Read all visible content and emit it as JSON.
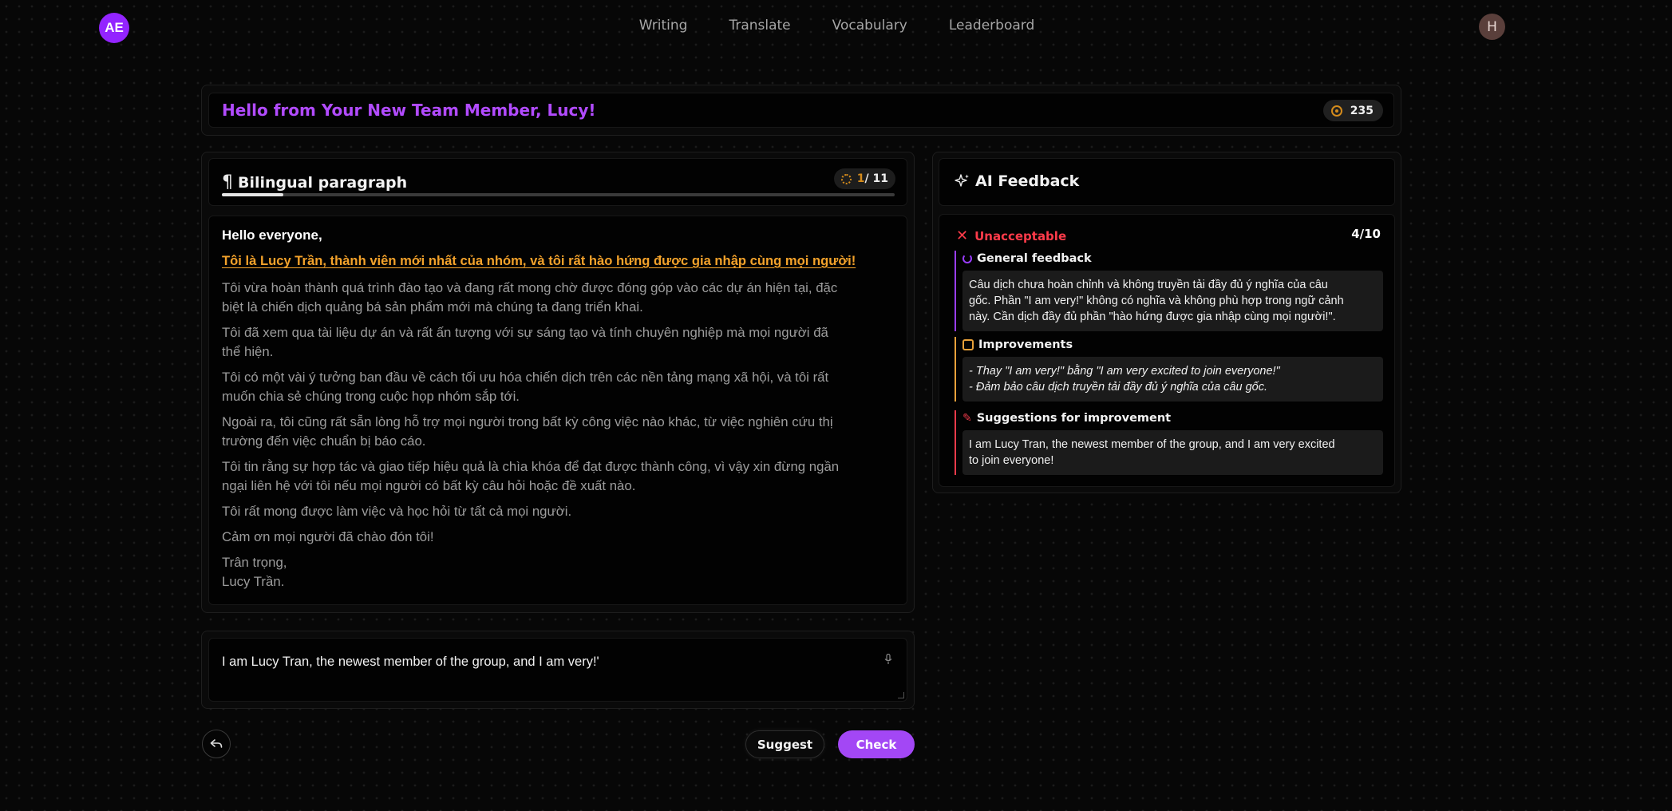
{
  "nav": {
    "user_initials": "AE",
    "links": [
      "Writing",
      "Translate",
      "Vocabulary",
      "Leaderboard"
    ],
    "profile_initial": "H"
  },
  "header": {
    "title": "Hello from Your New Team Member, Lucy!",
    "score": "235"
  },
  "paragraph_panel": {
    "title": "Bilingual paragraph",
    "progress_current": "1",
    "progress_total": "/ 11",
    "progress_fraction": 0.091,
    "greeting": "Hello everyone,",
    "active_sentence": "Tôi là Lucy Trần, thành viên mới nhất của nhóm, và tôi rất hào hứng được gia nhập cùng mọi người!",
    "paragraphs": [
      [
        "Tôi vừa hoàn thành quá trình đào tạo và đang rất mong chờ được đóng góp vào các dự án hiện tại, đặc",
        "biệt là chiến dịch quảng bá sản phẩm mới mà chúng ta đang triển khai."
      ],
      [
        "Tôi đã xem qua tài liệu dự án và rất ấn tượng với sự sáng tạo và tính chuyên nghiệp mà mọi người đã",
        "thể hiện."
      ],
      [
        "Tôi có một vài ý tưởng ban đầu về cách tối ưu hóa chiến dịch trên các nền tảng mạng xã hội, và tôi rất",
        "muốn chia sẻ chúng trong cuộc họp nhóm sắp tới."
      ],
      [
        "Ngoài ra, tôi cũng rất sẵn lòng hỗ trợ mọi người trong bất kỳ công việc nào khác, từ việc nghiên cứu thị",
        "trường đến việc chuẩn bị báo cáo."
      ],
      [
        "Tôi tin rằng sự hợp tác và giao tiếp hiệu quả là chìa khóa để đạt được thành công, vì vậy xin đừng ngần",
        "ngại liên hệ với tôi nếu mọi người có bất kỳ câu hỏi hoặc đề xuất nào."
      ],
      [
        "Tôi rất mong được làm việc và học hỏi từ tất cả mọi người."
      ],
      [
        "Cảm ơn mọi người đã chào đón tôi!"
      ],
      [
        "Trân trọng,",
        "Lucy Trần."
      ]
    ]
  },
  "answer": {
    "value": "I am Lucy Tran, the newest member of the group, and I am very!'"
  },
  "actions": {
    "suggest_label": "Suggest",
    "check_label": "Check"
  },
  "feedback": {
    "title": "AI Feedback",
    "verdict": "Unacceptable",
    "score": "4/10",
    "general_title": "General feedback",
    "general_lines": [
      "Câu dịch chưa hoàn chỉnh và không truyền tải đầy đủ ý nghĩa của câu",
      "gốc. Phần \"I am very!\" không có nghĩa và không phù hợp trong ngữ cảnh",
      "này. Cần dịch đầy đủ phần \"hào hứng được gia nhập cùng mọi người!\"."
    ],
    "improvements_title": "Improvements",
    "improvements": [
      "- Thay \"I am very!\" bằng \"I am very excited to join everyone!\"",
      "- Đảm bảo câu dịch truyền tải đầy đủ ý nghĩa của câu gốc."
    ],
    "suggestions_title": "Suggestions for improvement",
    "suggestion_lines": [
      "I am Lucy Tran, the newest member of the group, and I am very excited",
      "to join everyone!"
    ]
  },
  "colors": {
    "accent_purple": "#a347f5",
    "highlight_orange": "#f3a22b",
    "error_red": "#ff3b4a"
  }
}
